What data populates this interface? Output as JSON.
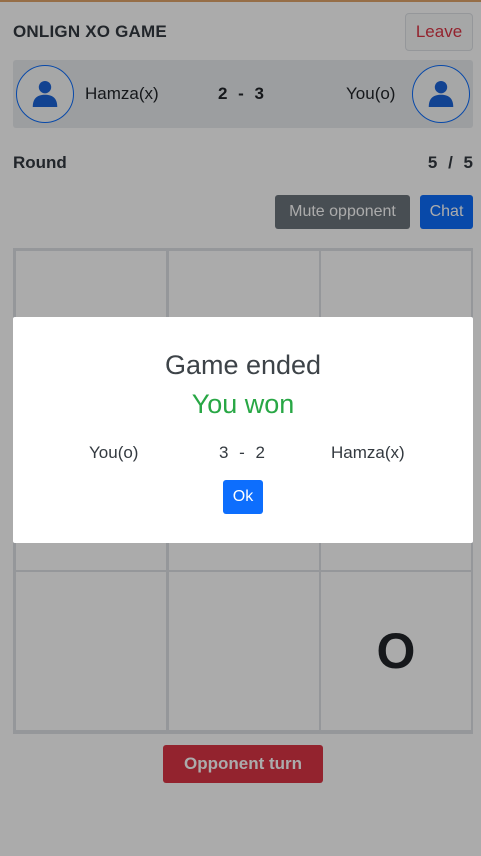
{
  "app": {
    "title": "ONLIGN XO GAME",
    "leave_label": "Leave"
  },
  "players": {
    "left": {
      "name": "Hamza(x)",
      "icon": "user-icon"
    },
    "right": {
      "name": "You(o)",
      "icon": "user-icon"
    },
    "score": "2 - 3"
  },
  "round": {
    "label": "Round",
    "value": "5 / 5"
  },
  "controls": {
    "mute_label": "Mute opponent",
    "chat_label": "Chat"
  },
  "board": {
    "cells": [
      "",
      "",
      "",
      "",
      "",
      "",
      "",
      "",
      "O"
    ]
  },
  "turn_label": "Opponent turn",
  "modal": {
    "title": "Game ended",
    "result": "You won",
    "you_name": "You(o)",
    "score": "3 - 2",
    "opponent_name": "Hamza(x)",
    "ok_label": "Ok"
  },
  "colors": {
    "primary": "#0d6efd",
    "danger": "#dc3545",
    "success": "#28a745",
    "secondary": "#6c757d"
  }
}
